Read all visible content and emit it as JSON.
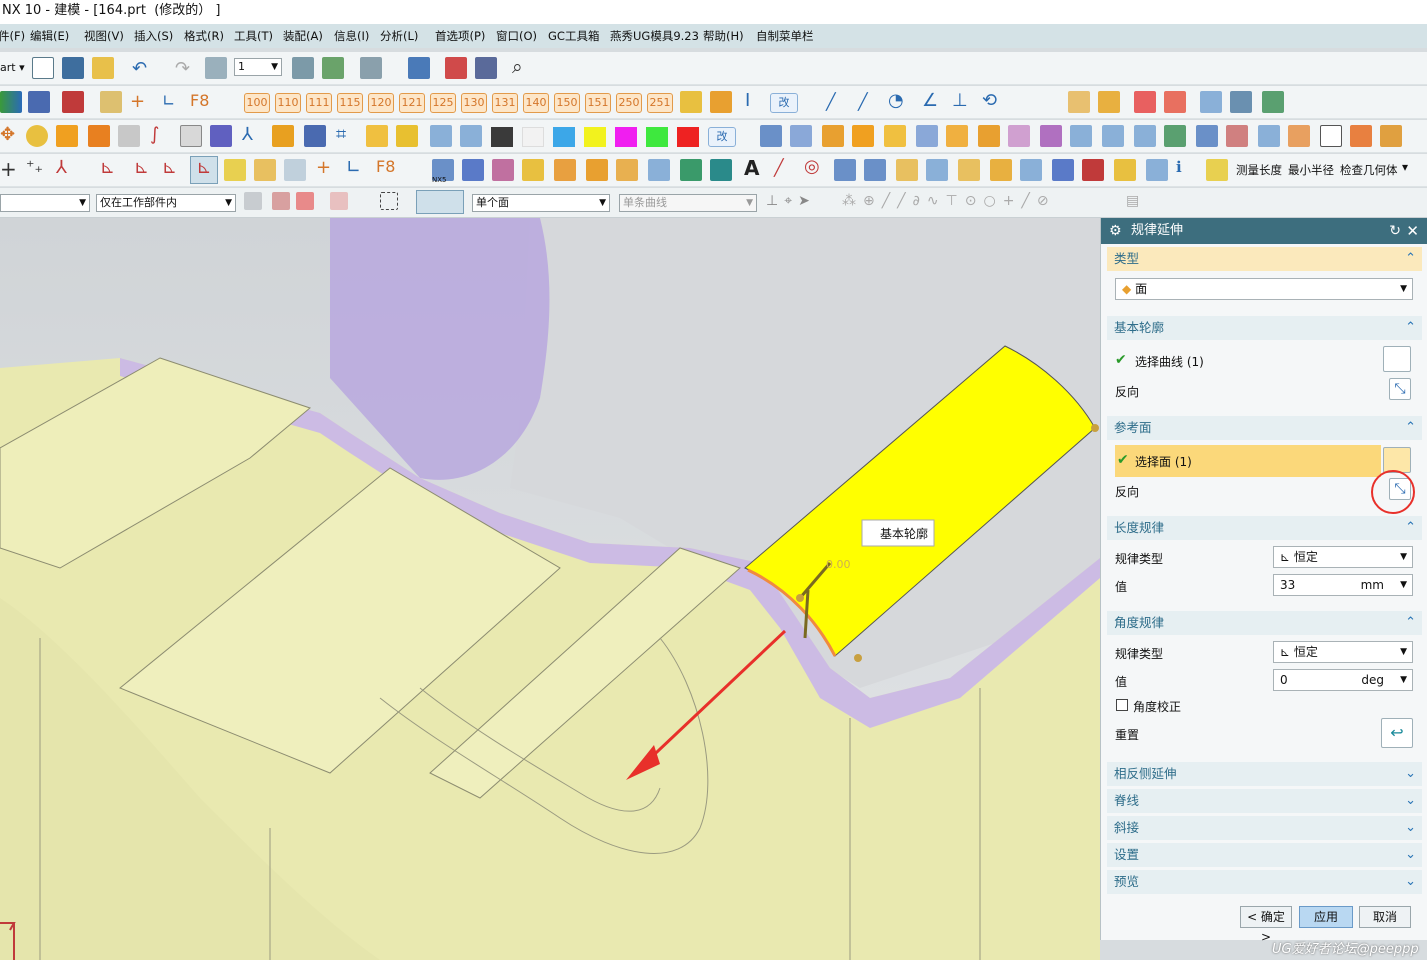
{
  "window": {
    "title": "NX 10 - 建模 - [164.prt  (修改的） ]"
  },
  "menubar": [
    "件(F)",
    "编辑(E)",
    "视图(V)",
    "插入(S)",
    "格式(R)",
    "工具(T)",
    "装配(A)",
    "信息(I)",
    "分析(L)",
    "首选项(P)",
    "窗口(O)",
    "GC工具箱",
    "燕秀UG模具9.23",
    "帮助(H)",
    "自制菜单栏"
  ],
  "toolbar1": {
    "start_label": "art",
    "layer_value": "1"
  },
  "toolbar2": {
    "layer_buttons": [
      "100",
      "110",
      "111",
      "115",
      "120",
      "121",
      "125",
      "130",
      "131",
      "140",
      "150",
      "151",
      "250",
      "251"
    ],
    "gai": "改"
  },
  "toolbar3": {
    "gai": "改",
    "colors": [
      "#3a3a3a",
      "#f2f2f2",
      "#3ca7e8",
      "#f2f21e",
      "#f01ef0",
      "#3ee83e",
      "#ee2222"
    ]
  },
  "toolbar4": {
    "f8": "F8",
    "nx5": "NX5",
    "measure_length": "测量长度",
    "min_radius": "最小半径",
    "check_geometry": "检查几何体"
  },
  "selection_bar": {
    "filter_value": "",
    "scope_value": "仅在工作部件内",
    "face_rule": "单个面",
    "curve_rule": "单条曲线"
  },
  "viewport": {
    "callout_label": "基本轮廓",
    "handle_value": "0.00"
  },
  "dialog": {
    "title": "规律延伸",
    "type": {
      "header": "类型",
      "value": "面"
    },
    "base_profile": {
      "header": "基本轮廓",
      "select_label": "选择曲线 (1)",
      "reverse_label": "反向"
    },
    "ref_face": {
      "header": "参考面",
      "select_label": "选择面 (1)",
      "reverse_label": "反向"
    },
    "length_law": {
      "header": "长度规律",
      "law_type_label": "规律类型",
      "law_type_value": "恒定",
      "value_label": "值",
      "value": "33",
      "unit": "mm"
    },
    "angle_law": {
      "header": "角度规律",
      "law_type_label": "规律类型",
      "law_type_value": "恒定",
      "value_label": "值",
      "value": "0",
      "unit": "deg",
      "angle_correct_label": "角度校正",
      "reset_label": "重置"
    },
    "collapsed": [
      "相反侧延伸",
      "脊线",
      "斜接",
      "设置",
      "预览"
    ],
    "buttons": {
      "ok": "< 确定 >",
      "apply": "应用",
      "cancel": "取消"
    }
  },
  "watermark": "UG爱好者论坛@peeppp"
}
